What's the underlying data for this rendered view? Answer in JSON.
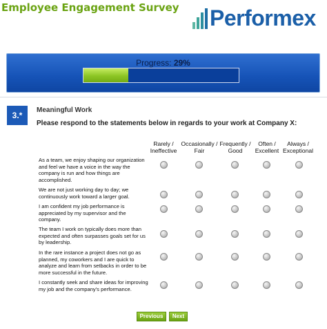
{
  "header": {
    "survey_title": "Employee Engagement Survey",
    "logo_text": "Performex"
  },
  "progress": {
    "label": "Progress:",
    "value_text": "29%",
    "value": 0.29
  },
  "question": {
    "number": "3.*",
    "section_title": "Meaningful Work",
    "instruction": "Please respond to the statements below in regards to your work at Company X:",
    "scale": [
      "Rarely / Ineffective",
      "Occasionally / Fair",
      "Frequently / Good",
      "Often / Excellent",
      "Always / Exceptional"
    ],
    "statements": [
      "As a team, we enjoy shaping our organization and feel we have a voice in the way the company is run and how things are accomplished.",
      "We are not just working day to day; we continuously work toward a larger goal.",
      "I am confident my job performance is appreciated by my supervisor and the company.",
      "The team I work on typically does more than expected and often surpasses goals set for us by leadership.",
      "In the rare instance a project does not go as planned, my coworkers and I are quick to analyze and learn from setbacks in order to be more successful in the future.",
      "I constantly seek and share ideas for improving my job and the company's performance."
    ]
  },
  "nav": {
    "previous_label": "Previous",
    "next_label": "Next"
  },
  "colors": {
    "brand_green": "#6aa312",
    "brand_blue": "#1b5fa8",
    "progress_blue": "#1653b7"
  }
}
